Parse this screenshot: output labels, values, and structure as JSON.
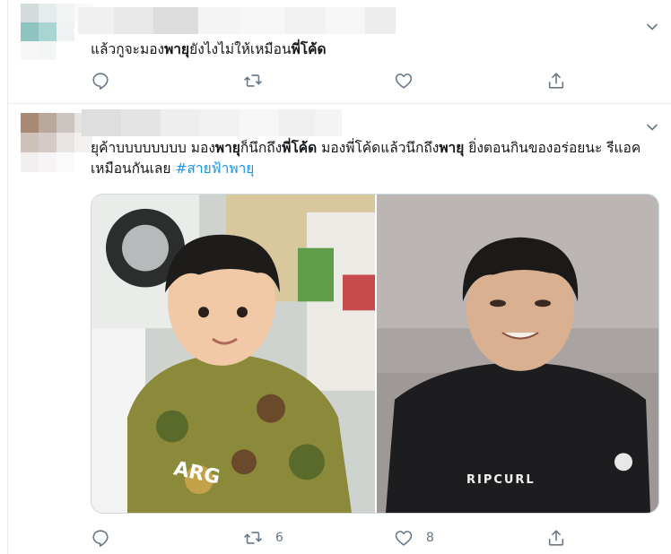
{
  "colors": {
    "text": "#14171a",
    "muted": "#657786",
    "hashtag": "#1b95e0",
    "divider": "#e6ecf0"
  },
  "tweets": [
    {
      "text_parts": [
        {
          "t": "แล้วกูจะมอง",
          "bold": false
        },
        {
          "t": "พายุ",
          "bold": true
        },
        {
          "t": "ยังไงไม่ให้เหมือน",
          "bold": false
        },
        {
          "t": "พี่โค้ด",
          "bold": true
        }
      ],
      "actions": {
        "reply_icon": "reply-icon",
        "retweet_icon": "retweet-icon",
        "like_icon": "heart-icon",
        "share_icon": "share-icon",
        "retweet_count": "",
        "like_count": ""
      }
    },
    {
      "text_parts": [
        {
          "t": "ยุค้าบบบบบบบบ มอง",
          "bold": false
        },
        {
          "t": "พายุ",
          "bold": true
        },
        {
          "t": "ก็นึกถึง",
          "bold": false
        },
        {
          "t": "พี่โค้ด",
          "bold": true
        },
        {
          "t": " มองพี่โค้ดแล้วนึกถึง",
          "bold": false
        },
        {
          "t": "พายุ",
          "bold": true
        },
        {
          "t": " ยิ่งตอนกินของอร่อยนะ รีแอคเหมือนกันเลย ",
          "bold": false
        }
      ],
      "hashtag": "#สายฟ้าพายุ",
      "media": {
        "left_shirt_text": "ARG",
        "right_shirt_text": "RIPCURL"
      },
      "actions": {
        "reply_icon": "reply-icon",
        "retweet_icon": "retweet-icon",
        "like_icon": "heart-icon",
        "share_icon": "share-icon",
        "retweet_count": "6",
        "like_count": "8"
      }
    }
  ]
}
